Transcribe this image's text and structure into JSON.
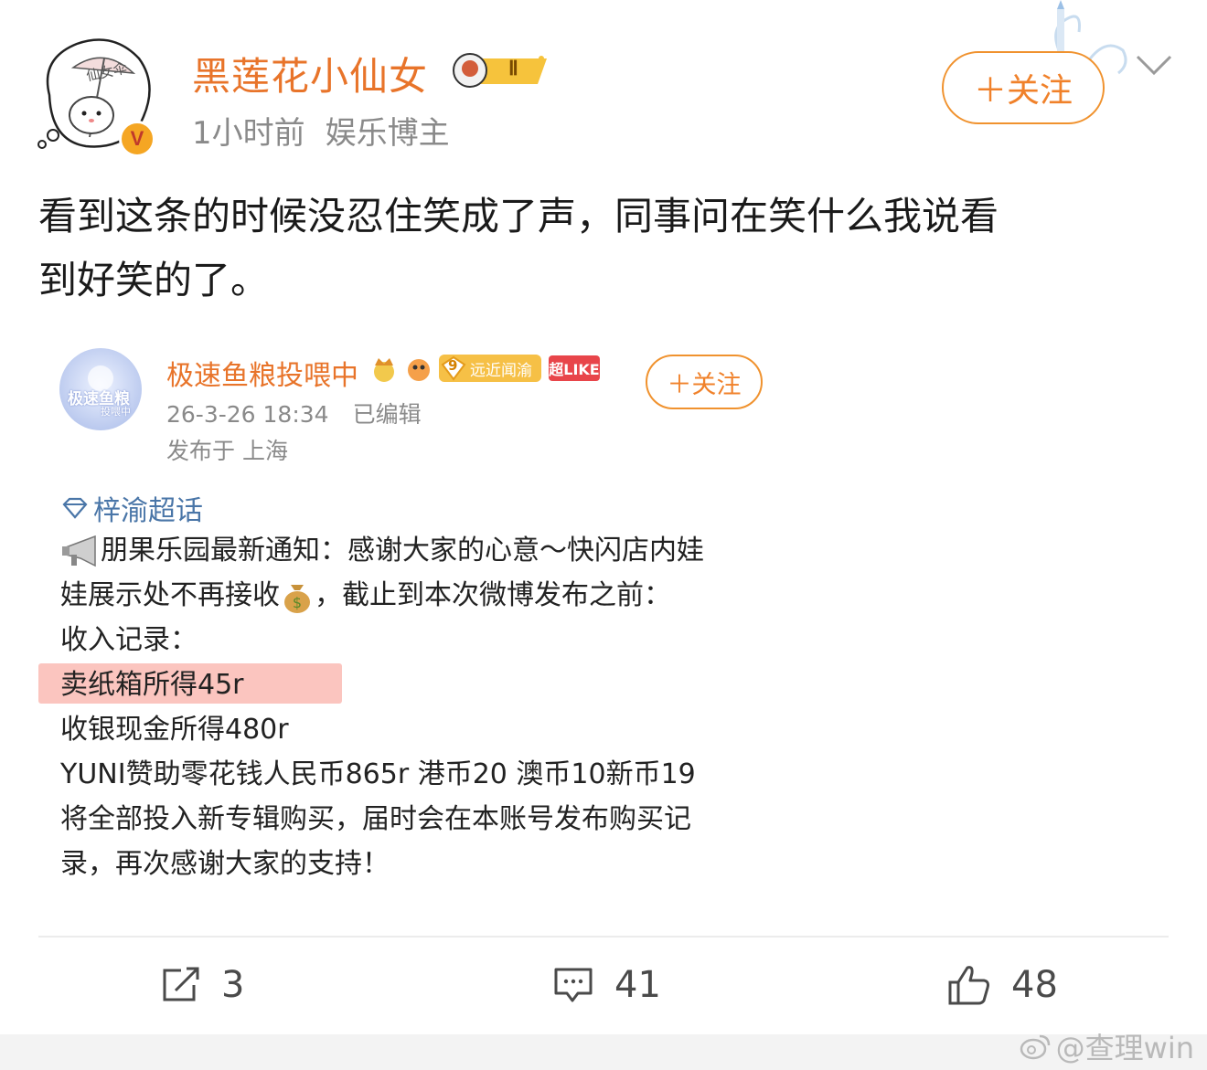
{
  "post": {
    "username": "黑莲花小仙女",
    "badge_label": "Ⅱ",
    "time": "1小时前",
    "tag": "娱乐博主",
    "follow_label": "＋关注",
    "avatar_sign": "仙女伞",
    "verified_mark": "V",
    "text_line1": "看到这条的时候没忍住笑成了声，同事问在笑什么我说看",
    "text_line2": "到好笑的了。"
  },
  "embedded": {
    "avatar_text1": "极速鱼粮",
    "avatar_text2": "投喂中",
    "username": "极速鱼粮投喂中",
    "badge_level": "9",
    "badge_text": "远近闻渝",
    "super_like": "超LIKE",
    "time": "26-3-26 18:34",
    "edited": "已编辑",
    "location": "发布于 上海",
    "follow_label": "＋关注",
    "topic": "梓渝超话",
    "lines": [
      "朋果乐园最新通知：感谢大家的心意～快闪店内娃",
      "娃展示处不再接收",
      "，截止到本次微博发布之前：",
      "收入记录：",
      "卖纸箱所得45r",
      "收银现金所得480r",
      "YUNI赞助零花钱人民币865r 港币20 澳币10新币19",
      "将全部投入新专辑购买，届时会在本账号发布购买记",
      "录，再次感谢大家的支持！"
    ]
  },
  "actions": {
    "repost_count": "3",
    "comment_count": "41",
    "like_count": "48"
  },
  "watermark": "@查理win",
  "colors": {
    "accent_orange": "#e8742a",
    "follow_border": "#f0922e",
    "topic_blue": "#4a76a8",
    "highlight": "#f9b2aa"
  },
  "icons": [
    "repost-icon",
    "comment-icon",
    "like-icon",
    "chevron-down-icon",
    "megaphone-icon",
    "money-bag-icon",
    "diamond-topic-icon",
    "weibo-logo-icon"
  ]
}
